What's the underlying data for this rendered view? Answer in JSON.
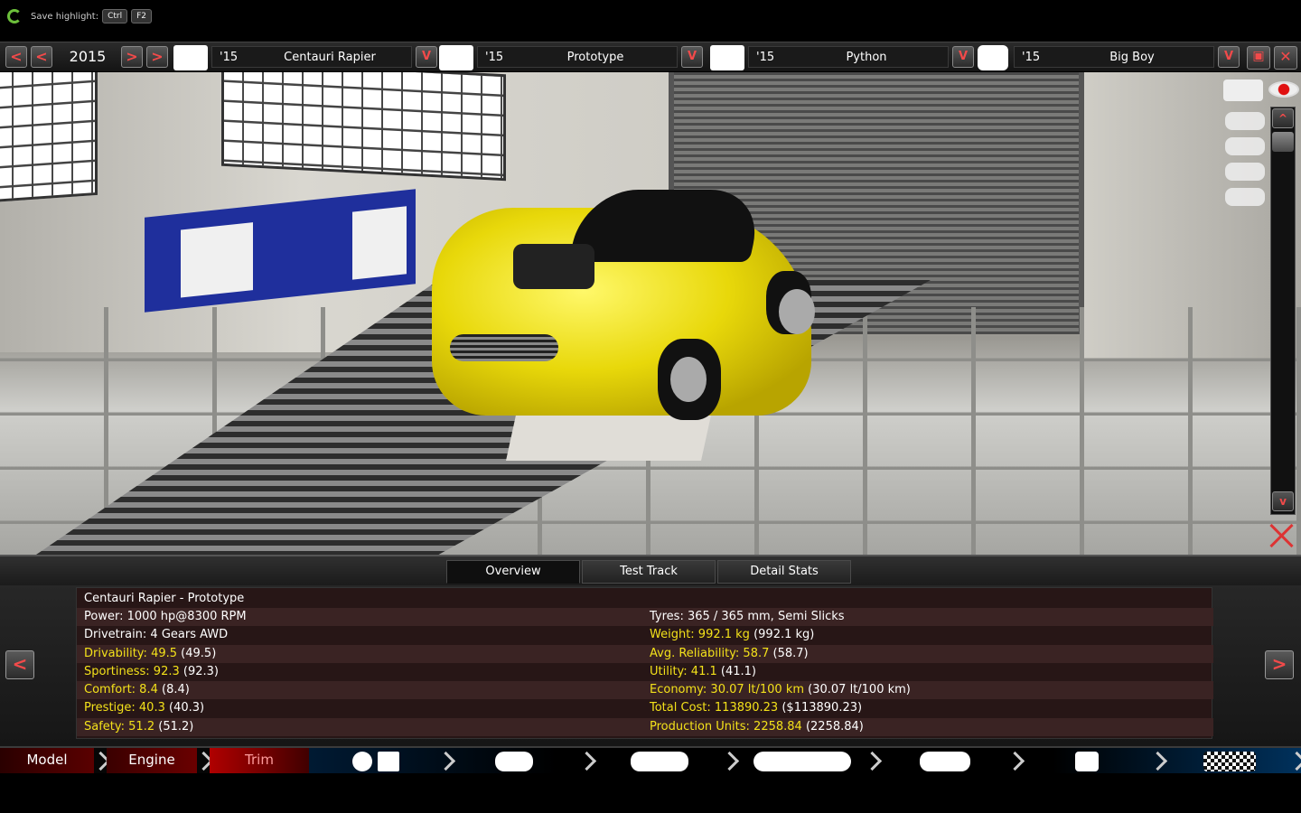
{
  "overlay": {
    "save_highlight": "Save highlight:",
    "key1": "Ctrl",
    "key2": "F2"
  },
  "selector": {
    "year": "2015",
    "slots": [
      {
        "year": "'15",
        "name": "Centauri  Rapier"
      },
      {
        "year": "'15",
        "name": "Prototype"
      },
      {
        "year": "'15",
        "name": "Python"
      },
      {
        "year": "'15",
        "name": "Big Boy"
      }
    ],
    "dropdown_glyph": "V"
  },
  "tabs": [
    "Overview",
    "Test Track",
    "Detail Stats"
  ],
  "stats": {
    "title": "Centauri  Rapier - Prototype",
    "left": [
      {
        "label": "Power: 1000 hp@8300 RPM",
        "paren": ""
      },
      {
        "label": "Drivetrain: 4 Gears AWD",
        "paren": ""
      },
      {
        "label": "Drivability: 49.5",
        "paren": "(49.5)"
      },
      {
        "label": "Sportiness: 92.3",
        "paren": "(92.3)"
      },
      {
        "label": "Comfort: 8.4",
        "paren": "(8.4)"
      },
      {
        "label": "Prestige: 40.3",
        "paren": "(40.3)"
      },
      {
        "label": "Safety: 51.2",
        "paren": "(51.2)"
      }
    ],
    "right": [
      {
        "label": "Tyres: 365 / 365 mm, Semi Slicks",
        "paren": ""
      },
      {
        "label": "Weight: 992.1 kg",
        "paren": "(992.1 kg)"
      },
      {
        "label": "Avg. Reliability: 58.7",
        "paren": "(58.7)"
      },
      {
        "label": "Utility: 41.1",
        "paren": "(41.1)"
      },
      {
        "label": "Economy: 30.07 lt/100 km",
        "paren": "(30.07 lt/100 km)"
      },
      {
        "label": "Total Cost: 113890.23",
        "paren": "($113890.23)"
      },
      {
        "label": "Production Units: 2258.84",
        "paren": "(2258.84)"
      }
    ]
  },
  "nav": {
    "model": "Model",
    "engine": "Engine",
    "trim": "Trim"
  },
  "colors": {
    "accent_red": "#f24a4a",
    "yellow_stat": "#f3e11a",
    "car_yellow": "#e8d80a"
  },
  "icons": [
    "refresh-icon",
    "car-sedan-icon",
    "van-icon",
    "engine-block-icon",
    "turbo-icon",
    "save-icon",
    "close-icon",
    "camera-icon",
    "eye-icon",
    "wheel-icon",
    "gearbox-icon",
    "fan-icon",
    "steering-wheel-icon",
    "seat-icon",
    "suspension-icon",
    "checkered-flag-icon"
  ]
}
